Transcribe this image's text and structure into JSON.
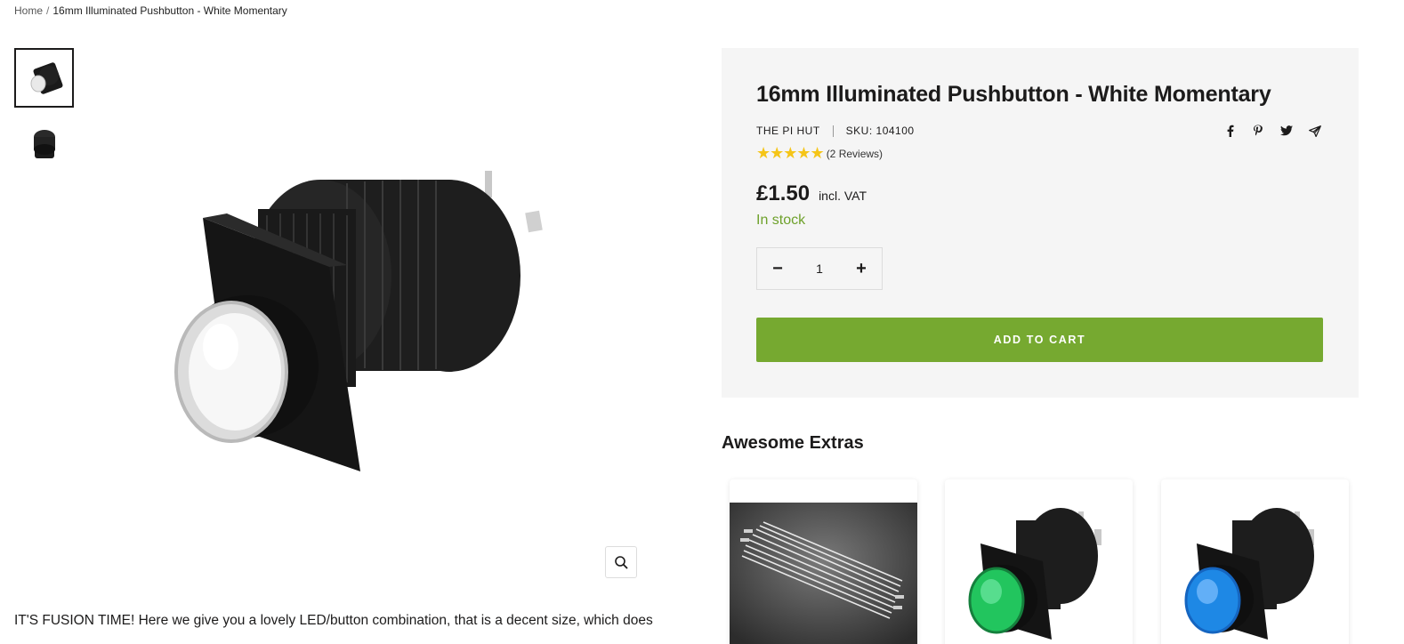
{
  "breadcrumb": {
    "home": "Home",
    "separator": "/",
    "current": "16mm Illuminated Pushbutton - White Momentary"
  },
  "gallery": {
    "thumbnails": [
      "pushbutton-angled-thumbnail",
      "pushbutton-top-thumbnail"
    ],
    "zoom_icon": "zoom-icon"
  },
  "product": {
    "title": "16mm Illuminated Pushbutton - White Momentary",
    "vendor": "The Pi Hut",
    "sku_label": "SKU:",
    "sku": "104100",
    "stars": "★★★★★",
    "rating": 5,
    "reviews": "(2 Reviews)",
    "price": "£1.50",
    "vat": "incl. VAT",
    "stock": "In stock",
    "quantity": "1",
    "decrement": "−",
    "increment": "+",
    "add_to_cart": "Add to cart",
    "share_icons": [
      "facebook-icon",
      "pinterest-icon",
      "twitter-icon",
      "email-share-icon"
    ]
  },
  "description": "IT'S FUSION TIME! Here we give you a lovely LED/button combination, that is a decent size, which does",
  "extras": {
    "title": "Awesome Extras",
    "items": [
      {
        "image": "jumper-wires-image"
      },
      {
        "image": "green-pushbutton-image",
        "color": "#2ecc71"
      },
      {
        "image": "blue-pushbutton-image",
        "color": "#1e88e5"
      }
    ]
  },
  "colors": {
    "accent_green": "#76a930",
    "stock_green": "#6ea12b",
    "star_yellow": "#f5c518",
    "panel_bg": "#f5f5f5"
  }
}
